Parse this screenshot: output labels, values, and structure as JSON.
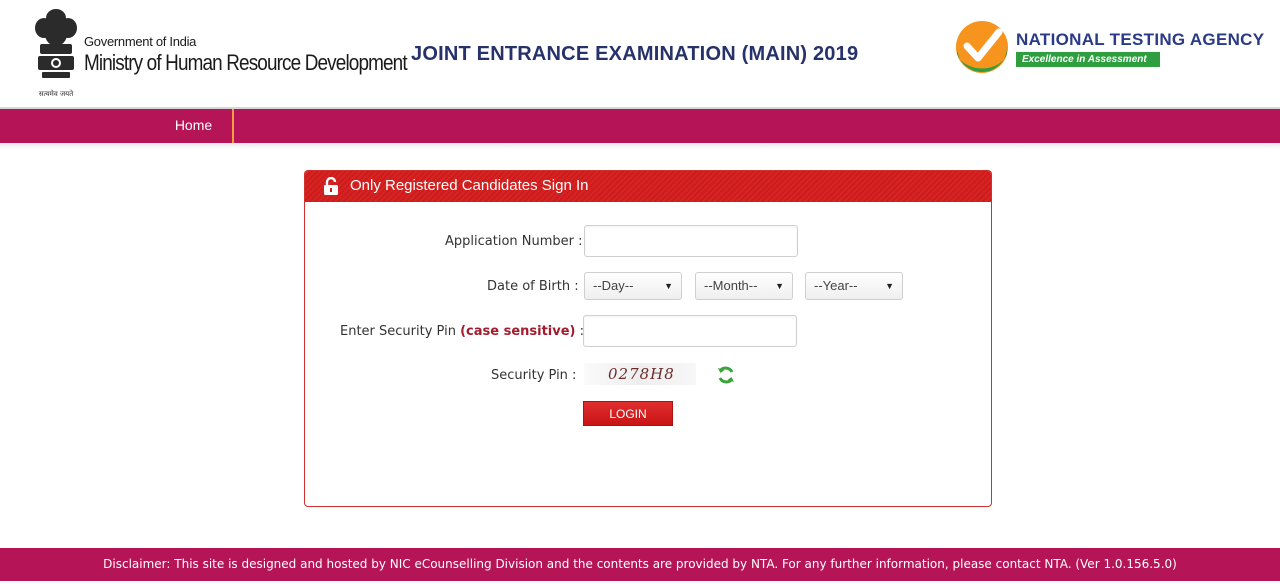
{
  "header": {
    "gov_small": "Government of India",
    "gov_big": "Ministry of Human Resource Development",
    "emblem_caption": "सत्यमेव जयते",
    "exam_title": "JOINT ENTRANCE EXAMINATION (MAIN) 2019",
    "agency_name": "NATIONAL TESTING AGENCY",
    "agency_tagline": "Excellence in Assessment"
  },
  "nav": {
    "home_label": "Home"
  },
  "panel": {
    "title": "Only Registered Candidates Sign In",
    "app_number_label": "Application Number :",
    "dob_label": "Date of Birth :",
    "day_selected": "--Day--",
    "month_selected": "--Month--",
    "year_selected": "--Year--",
    "security_pin_entry_label_main": "Enter Security Pin",
    "security_pin_entry_label_emph": "(case sensitive)",
    "security_pin_entry_label_colon": ":",
    "security_pin_label": "Security Pin :",
    "captcha_text": "0278H8",
    "login_label": "LOGIN"
  },
  "footer": {
    "disclaimer": "Disclaimer: This site is designed and hosted by NIC eCounselling Division and the contents are provided by NTA. For any further information, please contact NTA. (Ver 1.0.156.5.0)"
  },
  "colors": {
    "brand_magenta": "#b51456",
    "panel_red": "#cf1b1b",
    "title_blue": "#27326b",
    "nta_green": "#2e9e3e"
  },
  "icons": [
    "ashoka-emblem-icon",
    "nta-check-logo-icon",
    "lock-icon",
    "refresh-icon",
    "select-caret-icon"
  ]
}
